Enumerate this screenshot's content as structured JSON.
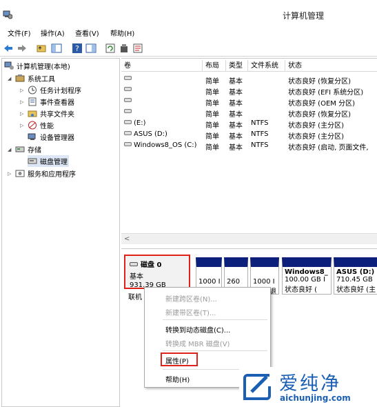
{
  "window": {
    "title": "计算机管理"
  },
  "menu": [
    "文件(F)",
    "操作(A)",
    "查看(V)",
    "帮助(H)"
  ],
  "toolbar_icons": [
    "back-arrow-icon",
    "forward-arrow-icon",
    "up-folder-icon",
    "show-tree-icon",
    "help-icon",
    "show-pane-icon",
    "refresh-icon",
    "properties-icon",
    "export-icon"
  ],
  "tree": {
    "root": "计算机管理(本地)",
    "system_tools": "系统工具",
    "task_scheduler": "任务计划程序",
    "event_viewer": "事件查看器",
    "shared_folders": "共享文件夹",
    "performance": "性能",
    "device_manager": "设备管理器",
    "storage": "存储",
    "disk_management": "磁盘管理",
    "services": "服务和应用程序"
  },
  "volumes": {
    "headers": [
      "卷",
      "布局",
      "类型",
      "文件系统",
      "状态"
    ],
    "rows": [
      {
        "name": "",
        "layout": "简单",
        "type": "基本",
        "fs": "",
        "status": "状态良好 (恢复分区)"
      },
      {
        "name": "",
        "layout": "简单",
        "type": "基本",
        "fs": "",
        "status": "状态良好 (EFI 系统分区)"
      },
      {
        "name": "",
        "layout": "简单",
        "type": "基本",
        "fs": "",
        "status": "状态良好 (OEM 分区)"
      },
      {
        "name": "",
        "layout": "简单",
        "type": "基本",
        "fs": "",
        "status": "状态良好 (恢复分区)"
      },
      {
        "name": "(E:)",
        "layout": "简单",
        "type": "基本",
        "fs": "NTFS",
        "status": "状态良好 (主分区)"
      },
      {
        "name": "ASUS (D:)",
        "layout": "简单",
        "type": "基本",
        "fs": "NTFS",
        "status": "状态良好 (主分区)"
      },
      {
        "name": "Windows8_OS (C:)",
        "layout": "简单",
        "type": "基本",
        "fs": "NTFS",
        "status": "状态良好 (启动, 页面文件,"
      }
    ]
  },
  "disk": {
    "name": "磁盘 0",
    "type": "基本",
    "size": "931.39 GB",
    "status": "联机",
    "partitions": [
      {
        "line1": "",
        "line2": "1000 I",
        "line3": ""
      },
      {
        "line1": "",
        "line2": "260",
        "line3": ""
      },
      {
        "line1": "",
        "line2": "1000 I",
        "line3": "退"
      },
      {
        "line1": "Windows8_",
        "line2": "100.00 GB I",
        "line3": "状态良好 ("
      },
      {
        "line1": "ASUS  (D:)",
        "line2": "710.45 GB",
        "line3": "状态良好 (主"
      }
    ]
  },
  "context_menu": {
    "new_spanned": "新建跨区卷(N)...",
    "new_striped": "新建带区卷(T)...",
    "convert_dynamic": "转换到动态磁盘(C)...",
    "convert_mbr": "转换成 MBR 磁盘(V)",
    "properties": "属性(P)",
    "help": "帮助(H)"
  },
  "watermark": {
    "brand": "爱纯净",
    "url": "aichunjing.com"
  },
  "colors": {
    "partition_bar": "#0c1f7a",
    "highlight_box": "#e0201a",
    "watermark_blue": "#1a5fb4"
  }
}
